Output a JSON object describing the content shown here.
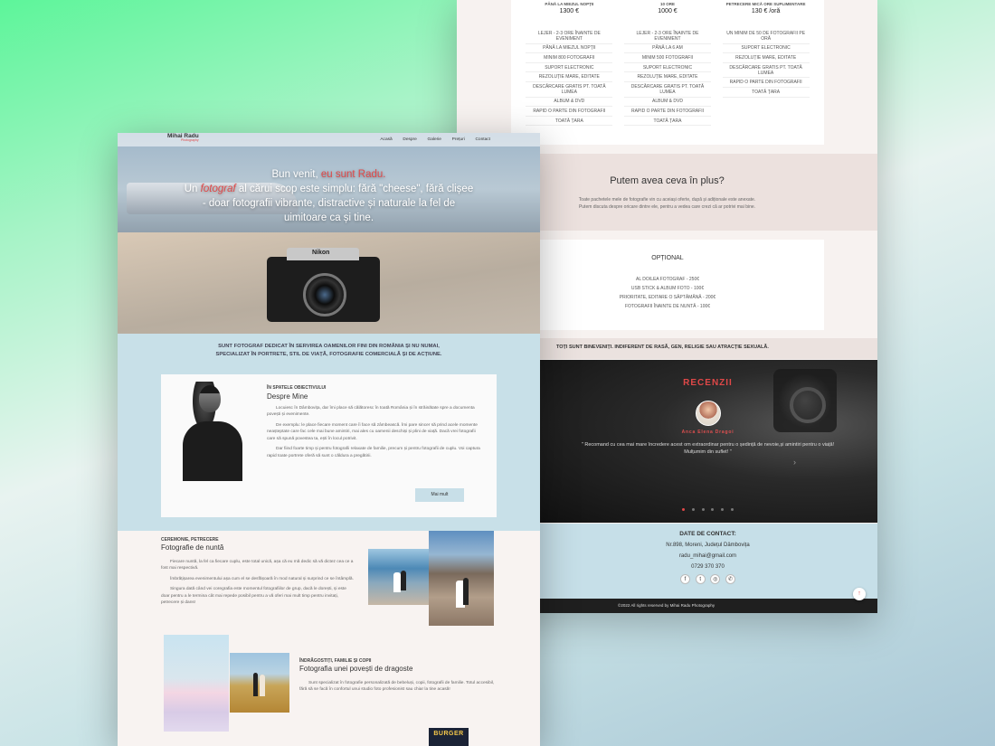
{
  "back": {
    "plans": [
      {
        "name": "Până la miezul nopții",
        "price": "1300 €",
        "features": [
          "Lejer - 2-3 ore înainte de eveniment",
          "Până la miezul nopții",
          "Minim 800 fotografii",
          "Suport electronic",
          "Rezoluție mare, editate",
          "Descărcare gratis pt. toată lumea",
          "Album & DVD",
          "Rapid o parte din fotografii",
          "Toată țara"
        ]
      },
      {
        "name": "10 ore",
        "price": "1000 €",
        "features": [
          "Lejer - 2-3 ore înainte de eveniment",
          "Până la 6 AM",
          "Minim 500 fotografii",
          "Suport electronic",
          "Rezoluție mare, editate",
          "Descărcare gratis pt. toată lumea",
          "Album & DVD",
          "Rapid o parte din fotografii",
          "Toată țara"
        ]
      },
      {
        "name": "Petrecere mică ore suplimentare",
        "price": "130 € /oră",
        "features": [
          "Un minim de 50 de fotografii pe oră",
          "Suport electronic",
          "Rezoluție mare, editate",
          "Descărcare gratis pt. toată lumea",
          "Rapid o parte din fotografii",
          "Toată țara"
        ]
      }
    ],
    "extra": {
      "title": "Putem avea ceva în plus?",
      "line1": "Toate pachetele mele de fotografie vin cu aceiași oferte, după și adiționale este anexate.",
      "line2": "Putem discuta despre oricare dintre ele, pentru a vedea care crezi că ar potrivi mai bine."
    },
    "optional": {
      "title": "Opțional",
      "items": [
        "Al doilea fotograf - 250€",
        "USB stick & album foto - 100€",
        "Prioritate, editare o săptămână - 200€",
        "Fotografii înainte de nuntă - 100€"
      ]
    },
    "inclusion": "Toți sunt bineveniți. Indiferent de rasă, gen, religie sau atracție sexuală.",
    "reviews": {
      "title": "RECENZII",
      "author": "Anca Elena Dragoi",
      "quote": "\" Recomand cu cea mai mare încredere acest om extraordinar pentru o ședință de nevoie,și amintiri pentru o viață! Mulțumim din suflet! \"",
      "next_icon": "›"
    },
    "contact": {
      "title": "Date de contact:",
      "address": "Nr.898, Moreni, Județul Dâmbovița",
      "email": "radu_mihai@gmail.com",
      "phone": "0729 370 370",
      "social_icons": [
        "facebook-icon",
        "twitter-icon",
        "instagram-icon",
        "whatsapp-icon"
      ],
      "social_glyphs": [
        "f",
        "t",
        "◎",
        "✆"
      ]
    },
    "footer": "©2022 All rights reserved by Mihai Radu Photography",
    "back_to_top": "↑"
  },
  "front": {
    "logo": "Mihai Radu",
    "logo_sub": "Photography",
    "nav": [
      "Acasă",
      "Despre",
      "Galerie",
      "Prețuri",
      "Contact"
    ],
    "hero": {
      "l1_a": "Bun venit, ",
      "l1_b": "eu sunt Radu.",
      "l2_a": "Un ",
      "l2_b": "fotograf",
      "l2_c": " al cărui scop este simplu: fără \"cheese\", fără clișee",
      "l3": "- doar fotografii vibrante, distractive și naturale la fel de",
      "l4": "uimitoare ca și tine.",
      "camera_brand": "Nikon"
    },
    "intro": {
      "line1": "Sunt fotograf dedicat în servirea oamenilor fini din România și nu numai,",
      "line2": "specializat în portrete, stil de viață, fotografie comercială și de acțiune."
    },
    "about": {
      "kicker": "În spatele obiectivului",
      "title": "Despre Mine",
      "p1": "Locuiesc în Dâmbovița, dar îmi place să călătoresc în toată România și în străinătate spre a documenta povești și evenimente.",
      "p2": "De exemplu: le place fiecare moment care îi face să zâmbească. Îmi pare sincer să prind acele momente neașteptate care fac cele mai bune amintiri, mai ales cu oamenii deschiși și plini de viață. Dacă vrei fotografii care să spună povestea ta, ești în locul potrivit.",
      "p3": "Dar fiind foarte timp și pentru fotografii relaxate de familie, precum și pentru fotografii de cuplu. Voi captura rapid toate portrete oferă să sunt o căldura a pregătirii.",
      "button": "Mai mult"
    },
    "wedding": {
      "kicker": "Ceremonie, petrecere",
      "title": "Fotografie de nuntă",
      "p1": "Fiecare nuntă, la fel ca fiecare cuplu, este total unică, așa că eu mă dedic să vă dictez cea ce a fost mai respectivă.",
      "p2": "Îmbrățișarea evenimentului așa cum el se desfășoară în mod natural și surprind ce se întâmplă.",
      "p3": "Singura dată când vei coregrafia este momentul fotografiilor de grup, dacă le dorești, și este doar pentru a le termina cât mai repede posibil pentru a vă oferi mai mult timp pentru invitați, petrecere și dans!"
    },
    "love": {
      "kicker": "Îndrăgostiți, familie și copii",
      "title": "Fotografia unei povești de dragoste",
      "p1": "Sunt specializat în fotografie personalizată de bebeluși, copii, fotografii de familie. Totul accesibil, fără să se facă în confortul unui studio foto profesionist sau chiar la tine acasă!"
    },
    "burger_text": "BURGER"
  }
}
